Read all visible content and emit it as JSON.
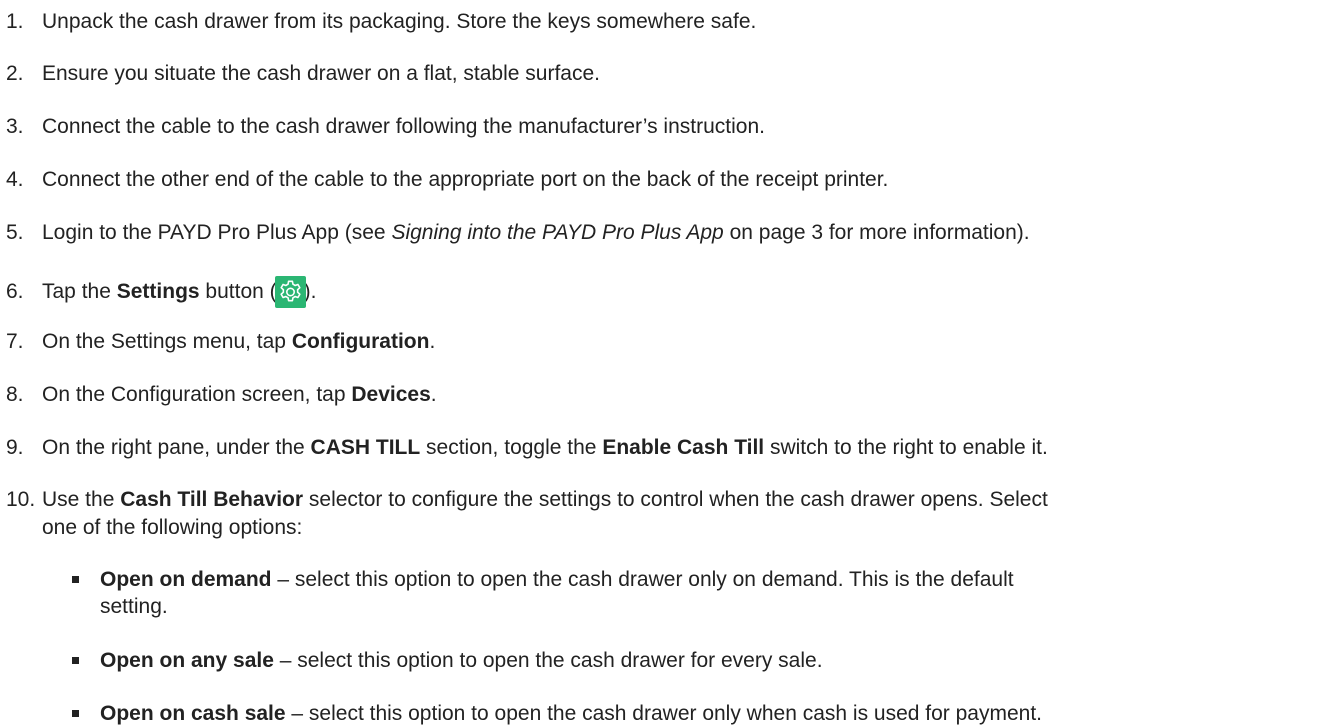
{
  "steps": [
    {
      "num": "1.",
      "text": "Unpack the cash drawer from its packaging. Store the keys somewhere safe."
    },
    {
      "num": "2.",
      "text": "Ensure you situate the cash drawer on a flat, stable surface."
    },
    {
      "num": "3.",
      "text": "Connect the cable to the cash drawer following the manufacturer’s instruction."
    },
    {
      "num": "4.",
      "text": "Connect the other end of the cable to the appropriate port on the back of the receipt printer."
    },
    {
      "num": "5.",
      "pre": "Login to the PAYD Pro Plus App (see ",
      "em": "Signing into the PAYD Pro Plus App",
      "post": " on page 3 for more information)."
    },
    {
      "num": "6.",
      "pre": "Tap the ",
      "bold": "Settings",
      "mid": " button (",
      "post": ")."
    },
    {
      "num": "7.",
      "pre": "On the Settings menu, tap ",
      "bold": "Configuration",
      "post": "."
    },
    {
      "num": "8.",
      "pre": "On the Configuration screen, tap ",
      "bold": "Devices",
      "post": "."
    },
    {
      "num": "9.",
      "pre": "On the right pane, under the ",
      "bold1": "CASH TILL",
      "mid": " section, toggle the ",
      "bold2": "Enable Cash Till",
      "post": " switch to the right to enable it."
    },
    {
      "num": "10.",
      "pre": "Use the ",
      "bold": "Cash Till Behavior",
      "post": " selector to configure the settings to control when the cash drawer opens. Select",
      "cont": "one of the following options:"
    }
  ],
  "options": [
    {
      "bold": "Open on demand",
      "text": " – select this option to open the cash drawer only on demand. This is the default",
      "cont": "setting."
    },
    {
      "bold": "Open on any sale",
      "text": " – select this option to open the cash drawer for every sale."
    },
    {
      "bold": "Open on cash sale",
      "text": " – select this option to open the cash drawer only when cash is used for payment."
    }
  ],
  "icons": {
    "settings": "gear-icon",
    "settings_color": "#2bb673"
  }
}
